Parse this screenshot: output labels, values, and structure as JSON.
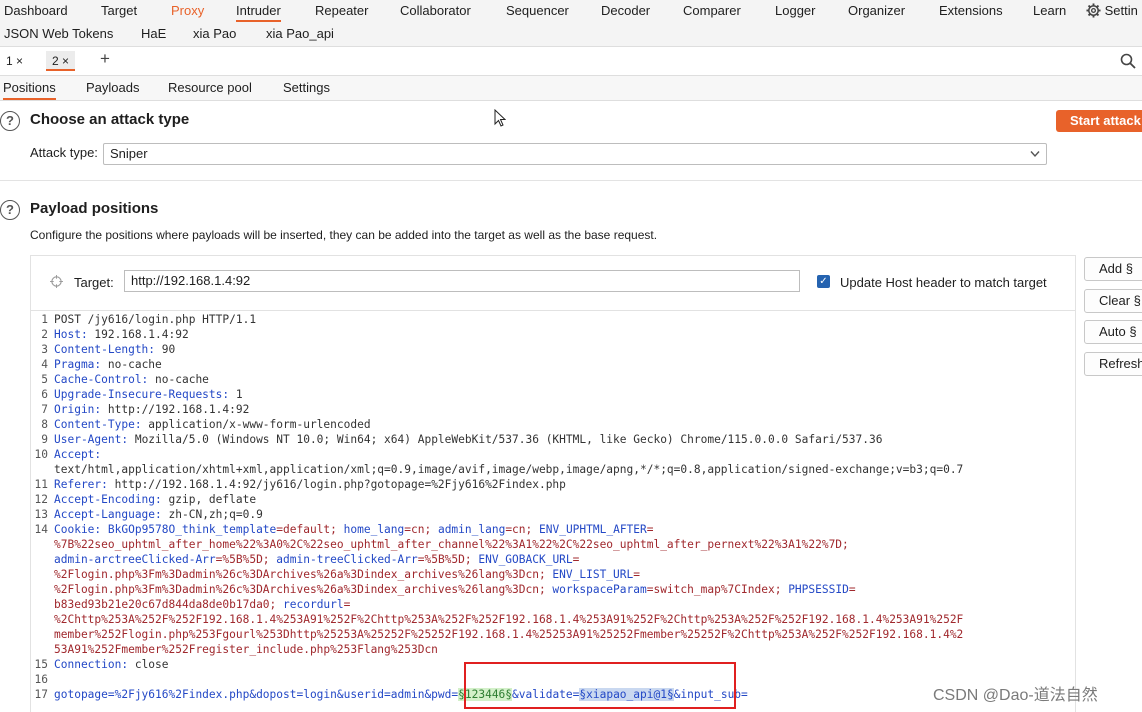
{
  "nav": {
    "tabs": [
      "Dashboard",
      "Target",
      "Proxy",
      "Intruder",
      "Repeater",
      "Collaborator",
      "Sequencer",
      "Decoder",
      "Comparer",
      "Logger",
      "Organizer",
      "Extensions",
      "Learn"
    ],
    "settings_label": "Settin",
    "sub_tabs": [
      "JSON Web Tokens",
      "HaE",
      "xia Pao",
      "xia Pao_api"
    ]
  },
  "request_tabs": [
    "1 ×",
    "2 ×"
  ],
  "add_tab": "+",
  "section_tabs": [
    "Positions",
    "Payloads",
    "Resource pool",
    "Settings"
  ],
  "attack_type": {
    "heading": "Choose an attack type",
    "label": "Attack type:",
    "value": "Sniper",
    "start_button": "Start attack"
  },
  "payload_positions": {
    "heading": "Payload positions",
    "description": "Configure the positions where payloads will be inserted, they can be added into the target as well as the base request.",
    "target_label": "Target:",
    "target_value": "http://192.168.1.4:92",
    "update_host_label": "Update Host header to match target",
    "update_host_checked": true,
    "side_buttons": [
      "Add §",
      "Clear §",
      "Auto §",
      "Refresh"
    ]
  },
  "request": {
    "line_numbers": [
      "1",
      "2",
      "3",
      "4",
      "5",
      "6",
      "7",
      "8",
      "9",
      "10",
      "11",
      "12",
      "13",
      "14",
      "15",
      "16",
      "17"
    ],
    "l1": "POST /jy616/login.php HTTP/1.1",
    "l2k": "Host:",
    "l2v": " 192.168.1.4:92",
    "l3k": "Content-Length:",
    "l3v": " 90",
    "l4k": "Pragma:",
    "l4v": " no-cache",
    "l5k": "Cache-Control:",
    "l5v": " no-cache",
    "l6k": "Upgrade-Insecure-Requests:",
    "l6v": " 1",
    "l7k": "Origin:",
    "l7v": " http://192.168.1.4:92",
    "l8k": "Content-Type:",
    "l8v": " application/x-www-form-urlencoded",
    "l9k": "User-Agent:",
    "l9v": " Mozilla/5.0 (Windows NT 10.0; Win64; x64) AppleWebKit/537.36 (KHTML, like Gecko) Chrome/115.0.0.0 Safari/537.36",
    "l10k": "Accept:",
    "l10v": "text/html,application/xhtml+xml,application/xml;q=0.9,image/avif,image/webp,image/apng,*/*;q=0.8,application/signed-exchange;v=b3;q=0.7",
    "l11k": "Referer:",
    "l11v": " http://192.168.1.4:92/jy616/login.php?gotopage=%2Fjy616%2Findex.php",
    "l12k": "Accept-Encoding:",
    "l12v": " gzip, deflate",
    "l13k": "Accept-Language:",
    "l13v": " zh-CN,zh;q=0.9",
    "l14k": "Cookie:",
    "c1k": " BkGOp9578O_think_template",
    "c1v": "=default;",
    "c2k": " home_lang",
    "c2v": "=cn;",
    "c3k": " admin_lang",
    "c3v": "=cn;",
    "c4k": " ENV_UPHTML_AFTER",
    "c4v": "=",
    "w2": "%7B%22seo_uphtml_after_home%22%3A0%2C%22seo_uphtml_after_channel%22%3A1%22%2C%22seo_uphtml_after_pernext%22%3A1%22%7D;",
    "w3a": "admin-arctreeClicked-Arr",
    "w3b": "=%5B%5D;",
    "w3c": " admin-treeClicked-Arr",
    "w3d": "=%5B%5D;",
    "w3e": " ENV_GOBACK_URL",
    "w3f": "=",
    "w4": "%2Flogin.php%3Fm%3Dadmin%26c%3DArchives%26a%3Dindex_archives%26lang%3Dcn;",
    "w4b": " ENV_LIST_URL",
    "w4c": "=",
    "w5a": "%2Flogin.php%3Fm%3Dadmin%26c%3DArchives%26a%3Dindex_archives%26lang%3Dcn;",
    "w5b": " workspaceParam",
    "w5c": "=switch_map%7CIndex;",
    "w5d": " PHPSESSID",
    "w5e": "=",
    "w6a": "b83ed93b21e20c67d844da8de0b17da0;",
    "w6b": " recordurl",
    "w6c": "=",
    "w7": "%2Chttp%253A%252F%252F192.168.1.4%253A91%252F%2Chttp%253A%252F%252F192.168.1.4%253A91%252F%2Chttp%253A%252F%252F192.168.1.4%253A91%252F",
    "w8": "member%252Flogin.php%253Fgourl%253Dhttp%25253A%25252F%25252F192.168.1.4%25253A91%25252Fmember%25252F%2Chttp%253A%252F%252F192.168.1.4%2",
    "w9": "53A91%252Fmember%252Fregister_include.php%253Flang%253Dcn",
    "l15k": "Connection:",
    "l15v": " close",
    "l16": "",
    "l17a": "gotopage=%2Fjy616%2Findex.php&dopost=login&userid=admin&pwd=",
    "l17p1": "§123446§",
    "l17b": "&validate=",
    "l17p2": "§xiapao_api@1§",
    "l17c": "&input_sub="
  },
  "watermark": "CSDN @Dao-道法自然"
}
